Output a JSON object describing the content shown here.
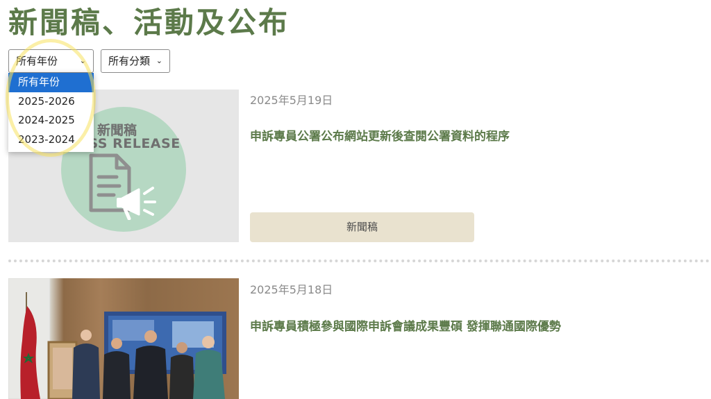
{
  "page": {
    "title": "新聞稿、活動及公布"
  },
  "filters": {
    "year": {
      "selected": "所有年份",
      "options": [
        "所有年份",
        "2025-2026",
        "2024-2025",
        "2023-2024"
      ]
    },
    "category": {
      "selected": "所有分類"
    }
  },
  "articles": [
    {
      "date": "2025年5月19日",
      "title": "申訴專員公署公布網站更新後查閱公署資料的程序",
      "category": "新聞稿",
      "thumbnail": {
        "title": "新聞稿",
        "subtitle": "ESS RELEASE"
      }
    },
    {
      "date": "2025年5月18日",
      "title": "申訴專員積極參與國際申訴會議成果豐碩 發揮聯通國際優勢"
    }
  ],
  "colors": {
    "heading": "#5c7a4a",
    "button_bg": "#e9e2cf",
    "selected_option": "#1f6fd1",
    "highlight": "#f7e15f"
  }
}
